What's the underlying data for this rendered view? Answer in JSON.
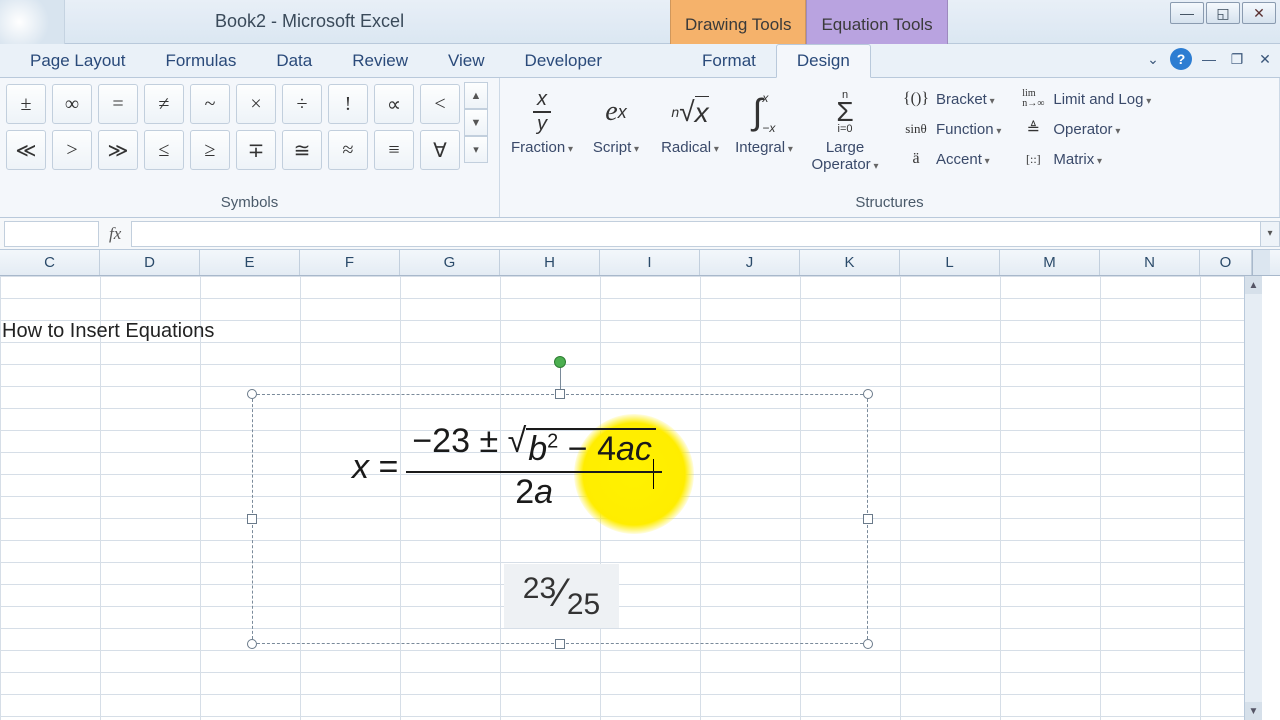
{
  "title": "Book2 - Microsoft Excel",
  "context_tabs": {
    "drawing": "Drawing Tools",
    "equation": "Equation Tools"
  },
  "tabs": {
    "t0": "",
    "page_layout": "Page Layout",
    "formulas": "Formulas",
    "data": "Data",
    "review": "Review",
    "view": "View",
    "developer": "Developer",
    "format": "Format",
    "design": "Design"
  },
  "symbols_group_label": "Symbols",
  "symbols_r1": {
    "s0": "±",
    "s1": "∞",
    "s2": "=",
    "s3": "≠",
    "s4": "~",
    "s5": "×",
    "s6": "÷",
    "s7": "!",
    "s8": "∝",
    "s9": "<"
  },
  "symbols_r2": {
    "s0": "≪",
    "s1": ">",
    "s2": "≫",
    "s3": "≤",
    "s4": "≥",
    "s5": "∓",
    "s6": "≅",
    "s7": "≈",
    "s8": "≡",
    "s9": "∀"
  },
  "structures_group_label": "Structures",
  "structures": {
    "fraction": "Fraction",
    "script": "Script",
    "radical": "Radical",
    "integral": "Integral",
    "large_op": "Large Operator",
    "bracket": "Bracket",
    "function": "Function",
    "accent": "Accent",
    "limit": "Limit and Log",
    "operator": "Operator",
    "matrix": "Matrix"
  },
  "namebox": "",
  "fx_label": "fx",
  "formula_value": "",
  "columns": {
    "c": "C",
    "d": "D",
    "e": "E",
    "f": "F",
    "g": "G",
    "h": "H",
    "i": "I",
    "j": "J",
    "k": "K",
    "l": "L",
    "m": "M",
    "n": "N",
    "o": "O"
  },
  "cell_text": "How to Insert Equations",
  "equation1": {
    "lhs_var": "x",
    "eq": "=",
    "minus23": "−23",
    "pm": "±",
    "b": "b",
    "sq": "2",
    "minus": "−",
    "four": "4",
    "a": "a",
    "c": "c",
    "den2": "2",
    "dena": "a"
  },
  "equation2": {
    "num": "23",
    "den": "25"
  }
}
